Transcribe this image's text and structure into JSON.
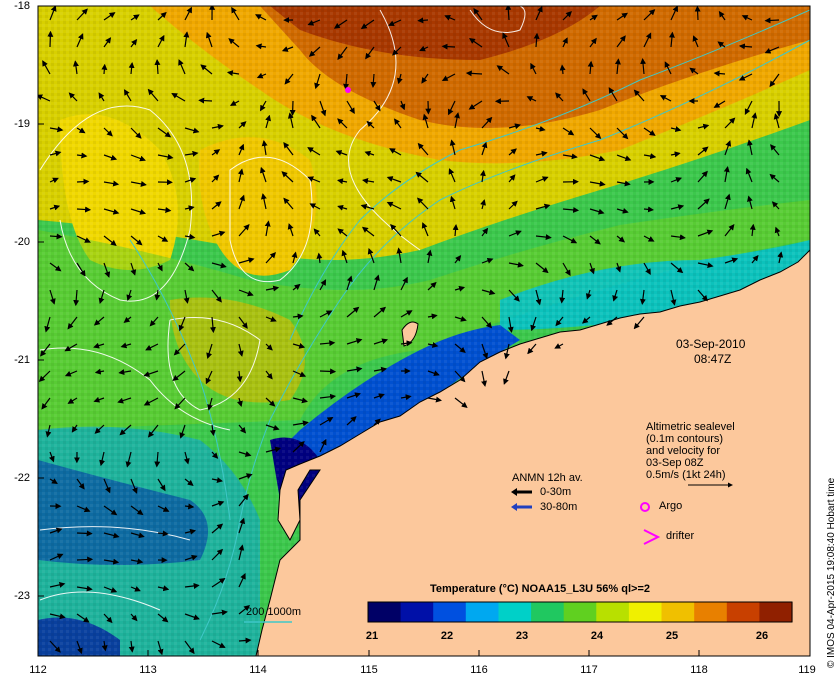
{
  "map": {
    "lon_ticks": [
      "112",
      "113",
      "114",
      "115",
      "116",
      "117",
      "118",
      "119"
    ],
    "lat_ticks": [
      "-18",
      "-19",
      "-20",
      "-21",
      "-22",
      "-23"
    ],
    "datetime": {
      "date": "03-Sep-2010",
      "time": "08:47Z"
    }
  },
  "legend": {
    "altimetry": {
      "line1": "Altimetric sealevel",
      "line2": "(0.1m contours)",
      "line3": "and velocity for",
      "line4": "03-Sep 08Z",
      "scale_label": "0.5m/s (1kt 24h)"
    },
    "anmn": {
      "title": "ANMN 12h av.",
      "item1": "0-30m",
      "item2": "30-80m",
      "item1_color": "#000000",
      "item2_color": "#1f3fbf"
    },
    "argo": {
      "label": "Argo",
      "color": "#ff00ff"
    },
    "drifter": {
      "label": "drifter",
      "color": "#ff00ff"
    },
    "isobath": {
      "label": "200  1000m",
      "color": "#3fc8c8"
    }
  },
  "colorbar": {
    "title": "Temperature (°C) NOAA15_L3U 56% ql>=2",
    "ticks": [
      "21",
      "22",
      "23",
      "24",
      "25",
      "26"
    ],
    "colors": [
      "#000066",
      "#0010a8",
      "#0050e0",
      "#00a8f0",
      "#00d0c8",
      "#20c860",
      "#60d020",
      "#b8e000",
      "#f0f000",
      "#f0c000",
      "#e88000",
      "#c84000",
      "#902000"
    ]
  },
  "credit": "© IMOS 04-Apr-2015 19:08:40 Hobart time"
}
